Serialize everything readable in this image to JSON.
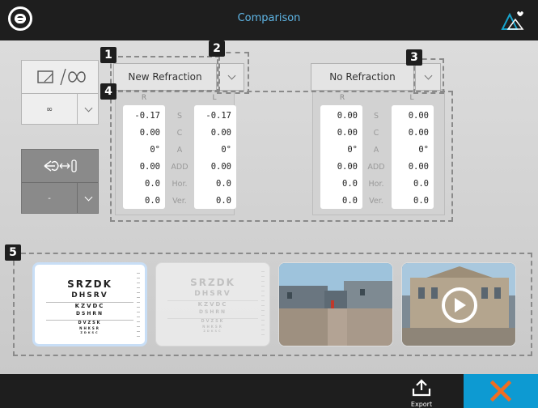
{
  "header": {
    "title": "Comparison"
  },
  "callouts": [
    "1",
    "2",
    "3",
    "4",
    "5"
  ],
  "left_controls": {
    "distance_value": "∞",
    "vision_value": "-"
  },
  "refraction_left": {
    "selected": "New Refraction",
    "col_r": "R",
    "col_l": "L",
    "rows": [
      {
        "label": "S",
        "r": "-0.17",
        "l": "-0.17"
      },
      {
        "label": "C",
        "r": "0.00",
        "l": "0.00"
      },
      {
        "label": "A",
        "r": "0°",
        "l": "0°"
      },
      {
        "label": "ADD",
        "r": "0.00",
        "l": "0.00"
      },
      {
        "label": "Hor.",
        "r": "0.0",
        "l": "0.0"
      },
      {
        "label": "Ver.",
        "r": "0.0",
        "l": "0.0"
      }
    ]
  },
  "refraction_right": {
    "selected": "No Refraction",
    "col_r": "R",
    "col_l": "L",
    "rows": [
      {
        "label": "S",
        "r": "0.00",
        "l": "0.00"
      },
      {
        "label": "C",
        "r": "0.00",
        "l": "0.00"
      },
      {
        "label": "A",
        "r": "0°",
        "l": "0°"
      },
      {
        "label": "ADD",
        "r": "0.00",
        "l": "0.00"
      },
      {
        "label": "Hor.",
        "r": "0.0",
        "l": "0.0"
      },
      {
        "label": "Ver.",
        "r": "0.0",
        "l": "0.0"
      }
    ]
  },
  "chart": {
    "line1": "SRZDK",
    "line2": "DHSRV",
    "line3": "KZVDC",
    "line4": "DSHRN",
    "line5": "DVZSK",
    "line6": "NHKSR",
    "line7": "ZDKSC"
  },
  "footer": {
    "export_label": "Export"
  },
  "colors": {
    "accent": "#0d9ad2",
    "title": "#5fb6e6",
    "close_x": "#f06d22"
  }
}
